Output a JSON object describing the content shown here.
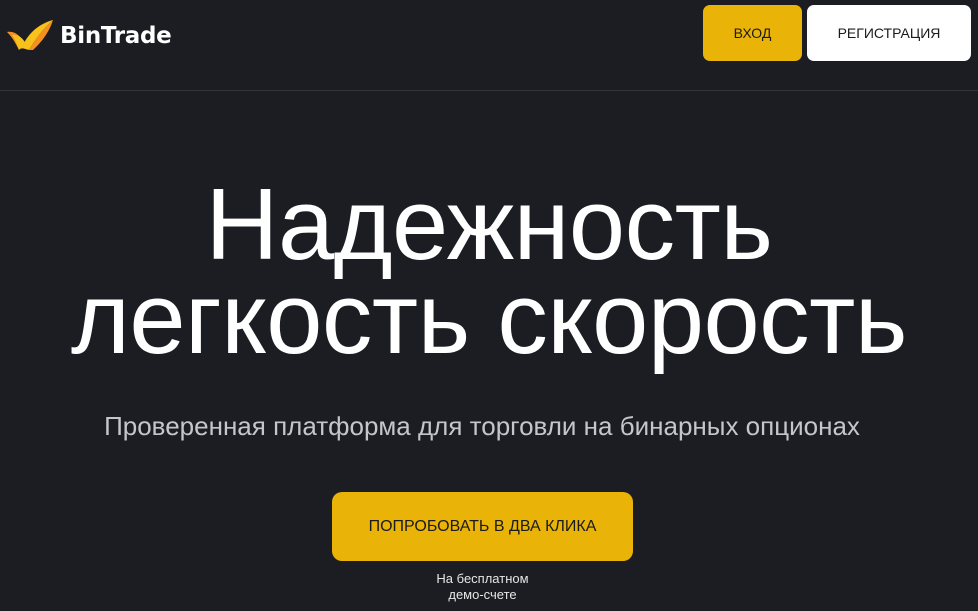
{
  "brand": {
    "name": "BinTrade",
    "logo_icon": "bintrade-logo-icon",
    "colors": {
      "orange": "#f5901e",
      "yellow": "#f8c21b",
      "accent": "#eab308"
    }
  },
  "header": {
    "login_label": "ВХОД",
    "register_label": "РЕГИСТРАЦИЯ"
  },
  "hero": {
    "title_line1": "Надежность",
    "title_line2": "легкость скорость",
    "subtitle": "Проверенная платформа для торговли на бинарных опционах",
    "cta_label": "ПОПРОБОВАТЬ В ДВА КЛИКА",
    "note_line1": "На бесплатном",
    "note_line2": "демо-счете"
  }
}
